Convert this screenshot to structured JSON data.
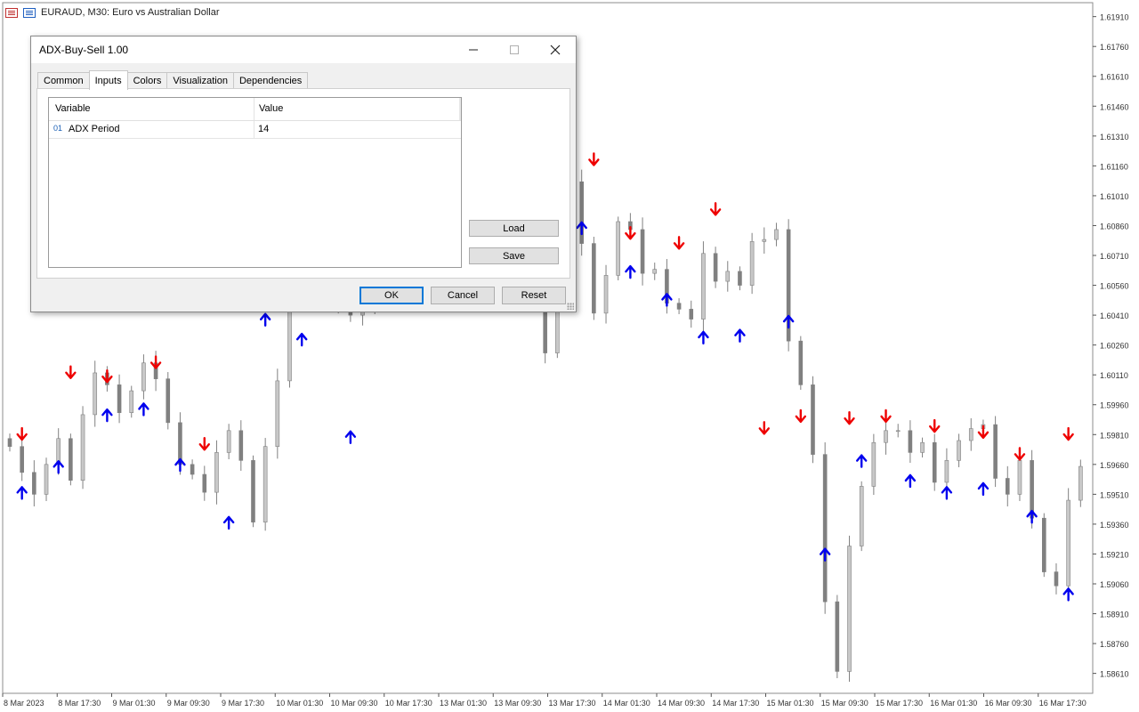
{
  "window": {
    "symbol_title": "EURAUD, M30:  Euro vs Australian Dollar"
  },
  "chart_data": {
    "type": "candlestick",
    "symbol": "EURAUD",
    "timeframe": "M30",
    "ylim": [
      1.5851,
      1.6198
    ],
    "price_ticks": [
      "1.61910",
      "1.61760",
      "1.61610",
      "1.61460",
      "1.61310",
      "1.61160",
      "1.61010",
      "1.60860",
      "1.60710",
      "1.60560",
      "1.60410",
      "1.60260",
      "1.60110",
      "1.59960",
      "1.59810",
      "1.59660",
      "1.59510",
      "1.59360",
      "1.59210",
      "1.59060",
      "1.58910",
      "1.58760",
      "1.58610"
    ],
    "time_ticks": [
      "8 Mar 2023",
      "8 Mar 17:30",
      "9 Mar 01:30",
      "9 Mar 09:30",
      "9 Mar 17:30",
      "10 Mar 01:30",
      "10 Mar 09:30",
      "10 Mar 17:30",
      "13 Mar 01:30",
      "13 Mar 09:30",
      "13 Mar 17:30",
      "14 Mar 01:30",
      "14 Mar 09:30",
      "14 Mar 17:30",
      "15 Mar 01:30",
      "15 Mar 09:30",
      "15 Mar 17:30",
      "16 Mar 01:30",
      "16 Mar 09:30",
      "16 Mar 17:30"
    ],
    "closes": [
      1.5975,
      1.5962,
      1.5951,
      1.5966,
      1.5979,
      1.5958,
      1.5991,
      1.6012,
      1.6006,
      1.5992,
      1.6003,
      1.6017,
      1.6009,
      1.5987,
      1.5966,
      1.5961,
      1.5952,
      1.5972,
      1.5983,
      1.5968,
      1.5937,
      1.5975,
      1.6008,
      1.6052,
      1.6065,
      1.6063,
      1.6059,
      1.6048,
      1.6041,
      1.6044,
      1.6069,
      1.6082,
      1.6088,
      1.6073,
      1.6092,
      1.6112,
      1.6099,
      1.6075,
      1.6091,
      1.6108,
      1.6113,
      1.6082,
      1.6066,
      1.6051,
      1.6022,
      1.6069,
      1.6108,
      1.6077,
      1.6042,
      1.6061,
      1.6088,
      1.6084,
      1.6062,
      1.6064,
      1.6047,
      1.6044,
      1.6039,
      1.6072,
      1.6058,
      1.6063,
      1.6056,
      1.6078,
      1.6079,
      1.6084,
      1.6028,
      1.6006,
      1.5971,
      1.5897,
      1.5862,
      1.5925,
      1.5955,
      1.5977,
      1.5983,
      1.5983,
      1.5972,
      1.5977,
      1.5957,
      1.5968,
      1.5978,
      1.5984,
      1.5986,
      1.5959,
      1.5951,
      1.5968,
      1.5939,
      1.5912,
      1.5905,
      1.5948,
      1.5965
    ],
    "buy_arrows": [
      1.5951,
      1.5964,
      1.599,
      1.5993,
      1.5965,
      1.5936,
      1.6038,
      1.6028,
      1.5979,
      1.6082,
      1.6074,
      1.6091,
      1.6084,
      1.6069,
      1.6084,
      1.6062,
      1.6048,
      1.6029,
      1.603,
      1.6037,
      1.592,
      1.5967,
      1.5957,
      1.5951,
      1.5953,
      1.5939,
      1.59
    ],
    "sell_arrows": [
      1.5982,
      1.6013,
      1.6011,
      1.6018,
      1.5977,
      1.6113,
      1.61,
      1.61,
      1.6124,
      1.6117,
      1.6131,
      1.6091,
      1.6097,
      1.612,
      1.6083,
      1.6078,
      1.6095,
      1.5985,
      1.5991,
      1.599,
      1.5991,
      1.5986,
      1.5983,
      1.5972,
      1.5982
    ],
    "colors": {
      "candle": "#808080",
      "buy_arrow": "#0000ee",
      "sell_arrow": "#ee0000"
    },
    "grid": false
  },
  "dialog": {
    "title": "ADX-Buy-Sell 1.00",
    "tabs": [
      "Common",
      "Inputs",
      "Colors",
      "Visualization",
      "Dependencies"
    ],
    "active_tab": "Inputs",
    "columns": {
      "variable": "Variable",
      "value": "Value"
    },
    "params": [
      {
        "type_badge": "01",
        "name": "ADX Period",
        "value": "14"
      }
    ],
    "load_label": "Load",
    "save_label": "Save",
    "ok_label": "OK",
    "cancel_label": "Cancel",
    "reset_label": "Reset",
    "minimize_icon": "minimize-icon",
    "maximize_icon": "maximize-icon",
    "close_icon": "close-icon"
  }
}
